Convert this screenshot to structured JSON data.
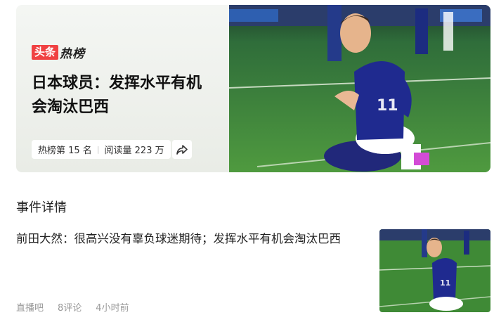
{
  "hero": {
    "badge": "头条",
    "brand": "热榜",
    "headline": "日本球员：发挥水平有机会淘汰巴西",
    "rank": "热榜第 15 名",
    "reads": "阅读量 223 万",
    "share_icon": "share-icon",
    "image": "soccer-player-celebrating-photo"
  },
  "section": {
    "title": "事件详情"
  },
  "news": {
    "title": "前田大然：很高兴没有辜负球迷期待；发挥水平有机会淘汰巴西",
    "source": "直播吧",
    "comments": "8评论",
    "time": "4小时前",
    "image": "soccer-player-celebrating-thumbnail"
  },
  "colors": {
    "accent_red": "#f04142",
    "hero_bg": "#eef1ec",
    "pitch_green": "#3f8a36",
    "jersey_blue": "#1f2a8f"
  }
}
